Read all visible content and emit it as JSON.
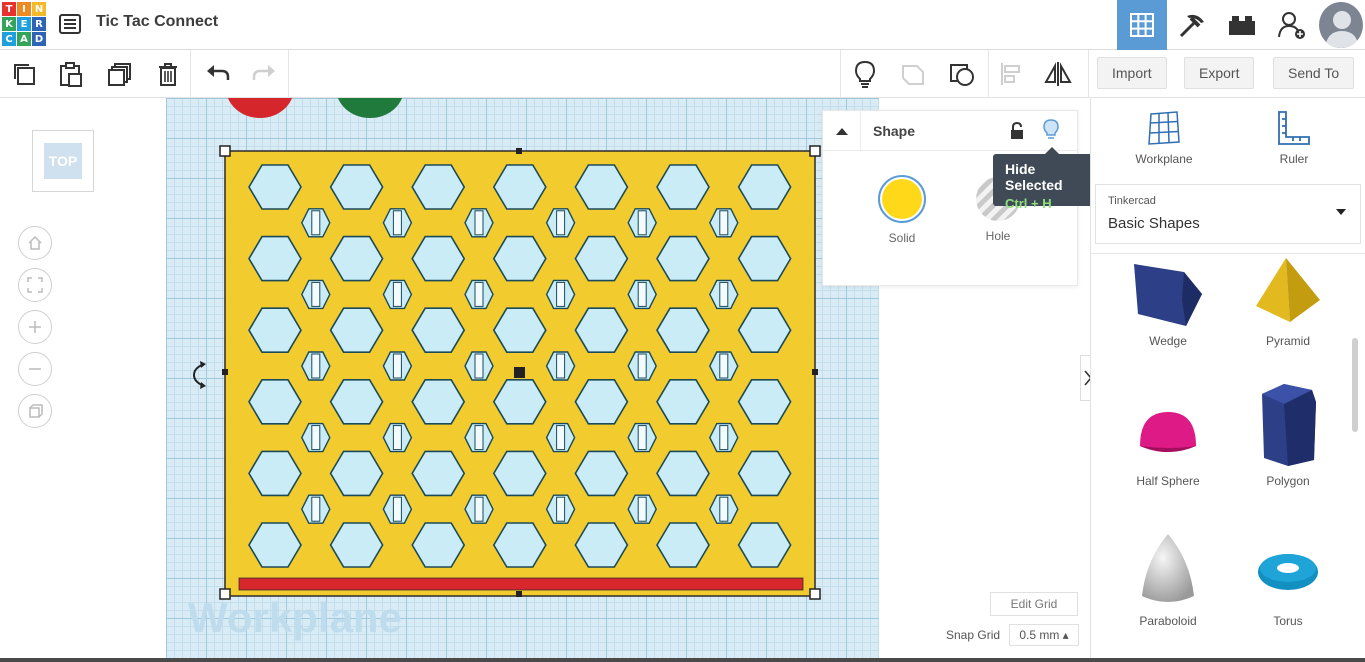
{
  "app": {
    "logo_letters": [
      "T",
      "I",
      "N",
      "K",
      "E",
      "R",
      "C",
      "A",
      "D"
    ],
    "logo_colors": [
      "#e8322f",
      "#ee8a22",
      "#f4b928",
      "#33a55a",
      "#1fa0dc",
      "#2e64b5",
      "#1fa0dc",
      "#33a55a",
      "#2e64b5"
    ],
    "title": "Tic Tac Connect"
  },
  "top_nav": {
    "icons": [
      "3d-view-icon",
      "pickaxe-icon",
      "bricks-icon",
      "add-user-icon",
      "user-avatar"
    ]
  },
  "toolbar": {
    "left_icons": [
      "copy-icon",
      "paste-icon",
      "duplicate-icon",
      "delete-icon",
      "undo-icon",
      "redo-icon"
    ],
    "right_icons": [
      "light-bulb-icon",
      "group-icon",
      "ungroup-icon",
      "align-icon",
      "mirror-icon"
    ],
    "import_label": "Import",
    "export_label": "Export",
    "sendto_label": "Send To"
  },
  "viewcube": {
    "label": "TOP"
  },
  "view_controls": [
    "home-icon",
    "fit-view-icon",
    "zoom-in-icon",
    "zoom-out-icon",
    "ortho-icon"
  ],
  "workplane_label": "Workplane",
  "shape_panel": {
    "title": "Shape",
    "solid_label": "Solid",
    "hole_label": "Hole",
    "solid_color": "#ffd81a"
  },
  "tooltip": {
    "title": "Hide Selected",
    "shortcut": "Ctrl + H"
  },
  "grid_controls": {
    "edit_grid": "Edit Grid",
    "snap_label": "Snap Grid",
    "snap_value": "0.5 mm ▴"
  },
  "sidebar": {
    "workplane_label": "Workplane",
    "ruler_label": "Ruler",
    "library_source": "Tinkercad",
    "library_name": "Basic Shapes",
    "shapes": [
      {
        "label": "Wedge",
        "icon": "wedge-icon"
      },
      {
        "label": "Pyramid",
        "icon": "pyramid-icon"
      },
      {
        "label": "Half Sphere",
        "icon": "half-sphere-icon"
      },
      {
        "label": "Polygon",
        "icon": "polygon-icon"
      },
      {
        "label": "Paraboloid",
        "icon": "paraboloid-icon"
      },
      {
        "label": "Torus",
        "icon": "torus-icon"
      }
    ]
  },
  "board": {
    "board_color": "#f2cb2e",
    "hole_color": "#c9ecf7",
    "bar_color": "#d7262c",
    "hex_rows": 6,
    "hex_cols": 7,
    "slot_rows": 5,
    "slot_cols": 6
  }
}
